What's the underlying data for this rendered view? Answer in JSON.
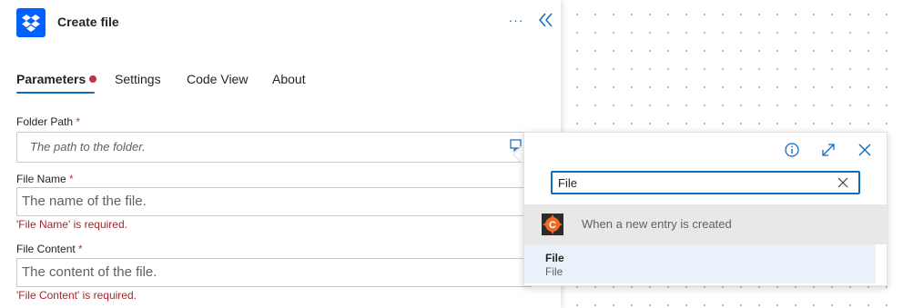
{
  "header": {
    "title": "Create file",
    "more_label": "···"
  },
  "tabs": [
    {
      "label": "Parameters"
    },
    {
      "label": "Settings"
    },
    {
      "label": "Code View"
    },
    {
      "label": "About"
    }
  ],
  "form": {
    "folder_path": {
      "label": "Folder Path",
      "required_marker": "*",
      "placeholder": "The path to the folder."
    },
    "file_name": {
      "label": "File Name",
      "required_marker": "*",
      "placeholder": "The name of the file.",
      "error": "'File Name' is required."
    },
    "file_content": {
      "label": "File Content",
      "required_marker": "*",
      "placeholder": "The content of the file.",
      "error": "'File Content' is required."
    }
  },
  "popup": {
    "search_value": "File",
    "group": {
      "label": "When a new entry is created",
      "logo_letter": "C"
    },
    "items": [
      {
        "title": "File",
        "subtitle": "File"
      }
    ]
  },
  "colors": {
    "accent": "#0f6cbd",
    "error": "#a4262c",
    "dropbox": "#0061fe",
    "required": "#c4314b"
  }
}
